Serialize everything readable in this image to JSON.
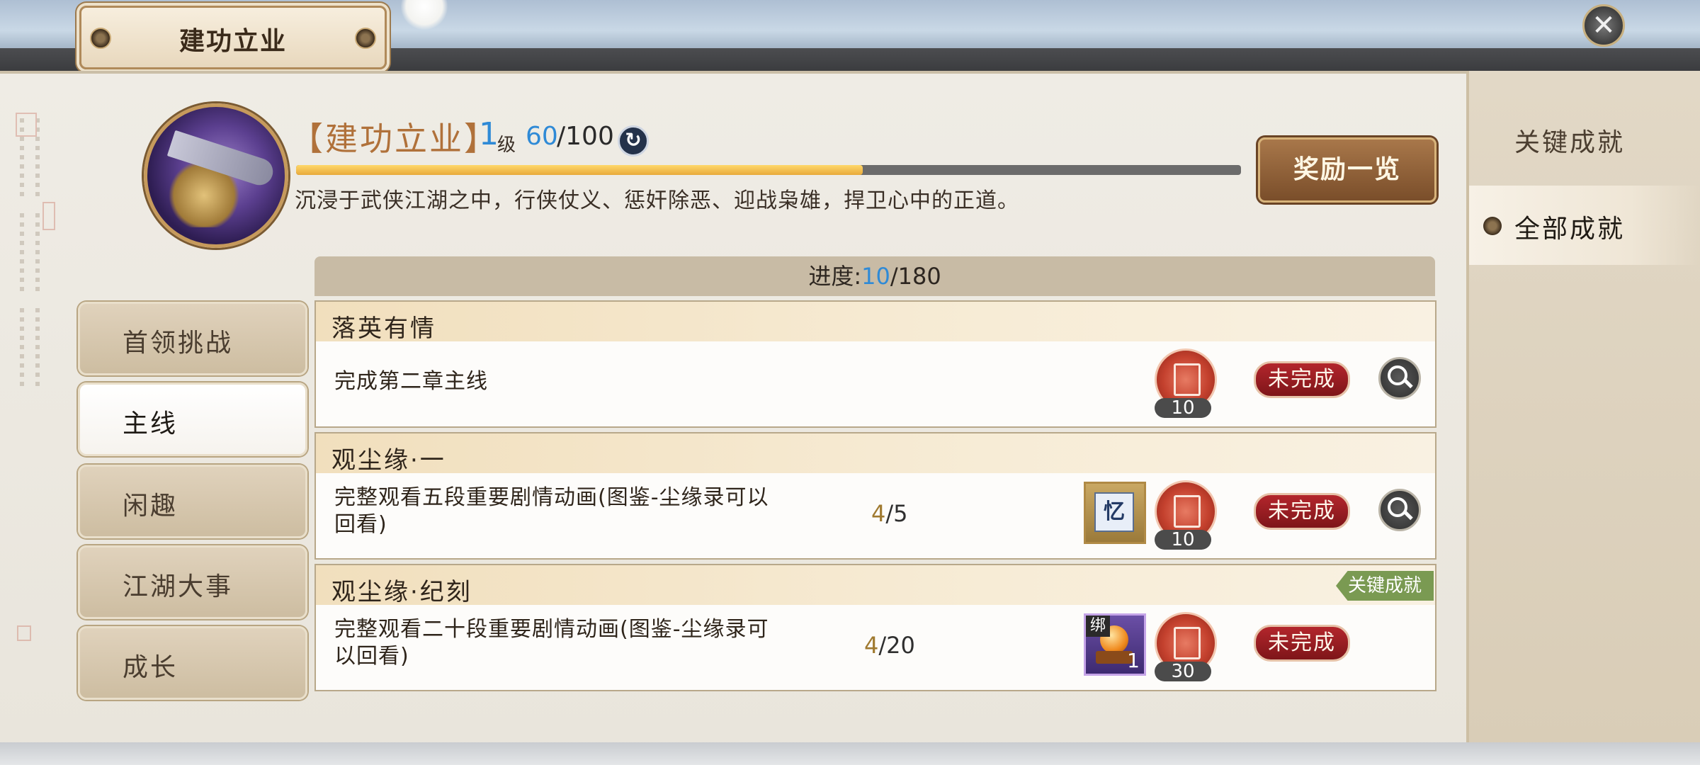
{
  "window": {
    "title": "建功立业",
    "close_symbol": "✕"
  },
  "header": {
    "title_bracketed": "【建功立业】",
    "level": "1",
    "level_suffix": "级",
    "exp_current": "60",
    "exp_total": "/100",
    "exp_progress": 0.6,
    "refresh_symbol": "↻",
    "description": "沉浸于武侠江湖之中，行侠仗义、惩奸除恶、迎战枭雄，捍卫心中的正道。",
    "reward_button": "奖励一览"
  },
  "right_tabs": [
    {
      "label": "关键成就",
      "active": false
    },
    {
      "label": "全部成就",
      "active": true
    }
  ],
  "categories": [
    {
      "label": "首领挑战",
      "active": false
    },
    {
      "label": "主线",
      "active": true
    },
    {
      "label": "闲趣",
      "active": false
    },
    {
      "label": "江湖大事",
      "active": false
    },
    {
      "label": "成长",
      "active": false
    }
  ],
  "progress": {
    "label": "进度:",
    "current": "10",
    "total": "/180"
  },
  "achievements": [
    {
      "name": "落英有情",
      "desc_line1": "完成第二章主线",
      "desc_line2": "",
      "count_current": "",
      "count_total": "",
      "reward_count": "10",
      "status": "未完成"
    },
    {
      "name": "观尘缘·一",
      "desc_line1": "完整观看五段重要剧情动画(图鉴-尘缘录可以",
      "desc_line2": "回看)",
      "count_current": "4",
      "count_total": "/5",
      "item_label": "忆",
      "reward_count": "10",
      "status": "未完成"
    },
    {
      "name": "观尘缘·纪刻",
      "desc_line1": "完整观看二十段重要剧情动画(图鉴-尘缘录可",
      "desc_line2": "以回看)",
      "count_current": "4",
      "count_total": "/20",
      "item_bind": "绑",
      "item_qty": "1",
      "reward_count": "30",
      "status": "未完成",
      "badge": "关键成就"
    }
  ],
  "colors": {
    "accent_blue": "#2f8ad6",
    "status_red": "#b3262c",
    "key_badge_green": "#7a9a52",
    "title_orange": "#b0713a"
  },
  "icons": [
    "close-icon",
    "refresh-icon",
    "search-icon",
    "coin-icon",
    "knot-icon"
  ]
}
